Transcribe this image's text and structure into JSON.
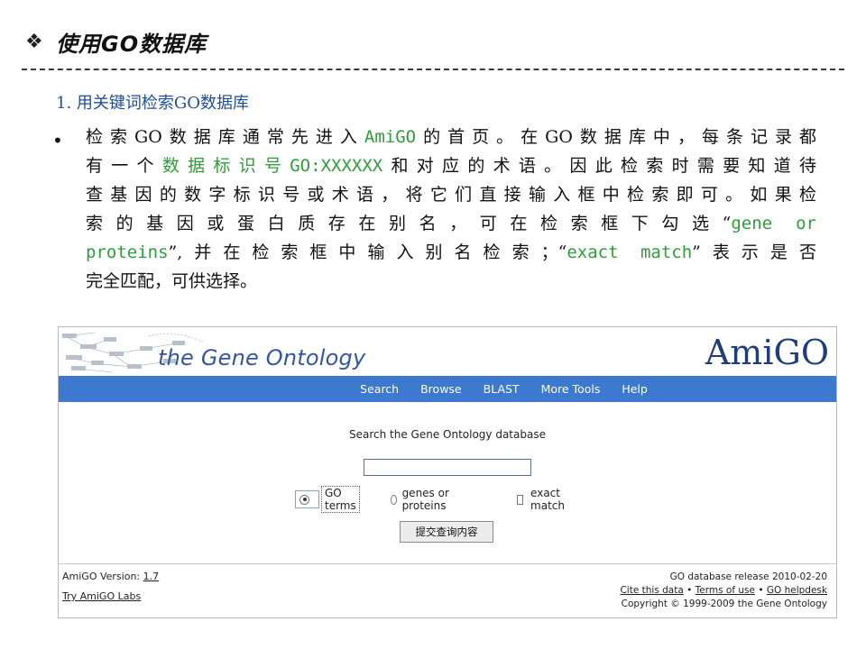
{
  "slide": {
    "bullet_symbol": "❖",
    "title": "使用GO数据库",
    "section_heading": "1. 用关键词检索GO数据库",
    "bullet_dot": "•",
    "paragraph_lines": [
      [
        {
          "t": "检索GO数据库通常先进入"
        },
        {
          "t": "AmiGO",
          "g": true
        },
        {
          "t": "的首页。在GO数据库中，每条记录都"
        }
      ],
      [
        {
          "t": "有一个"
        },
        {
          "t": "数据标识号GO:XXXXXX",
          "g": true
        },
        {
          "t": "和对应的术语。因此检索时需要知道待"
        }
      ],
      [
        {
          "t": "查基因的数字标识号或术语，将它们直接输入框中检索即可。如果检"
        }
      ],
      [
        {
          "t": "索的基因或蛋白质存在别名，可在检索框下勾选“"
        },
        {
          "t": "gene or",
          "g": true
        }
      ],
      [
        {
          "t": "proteins",
          "g": true
        },
        {
          "t": "”,并在检索框中输入别名检索；“"
        },
        {
          "t": "exact match",
          "g": true
        },
        {
          "t": "”表示是否"
        }
      ],
      [
        {
          "t": "完全匹配，可供选择。"
        }
      ]
    ],
    "highlight_color": "#2e9e3a"
  },
  "amigo": {
    "subtitle": "the Gene Ontology",
    "logo": "AmiGO",
    "nav": [
      "Search",
      "Browse",
      "BLAST",
      "More Tools",
      "Help"
    ],
    "search_label": "Search the Gene Ontology database",
    "search_value": "",
    "options": {
      "go_terms": "GO terms",
      "genes_or_proteins": "genes or proteins",
      "exact_match": "exact match",
      "selected": "go_terms",
      "exact_checked": false
    },
    "submit_label": "提交查询内容",
    "footer": {
      "version_label": "AmiGO Version:",
      "version_value": "1.7",
      "labs_link": "Try AmiGO Labs",
      "db_release": "GO database release 2010-02-20",
      "cite_link": "Cite this data",
      "sep": "•",
      "terms_link": "Terms of use",
      "helpdesk_link": "GO helpdesk",
      "copyright": "Copyright © 1999-2009 the Gene Ontology"
    },
    "nav_color": "#3d79cf",
    "logo_color": "#1e3d7b"
  }
}
